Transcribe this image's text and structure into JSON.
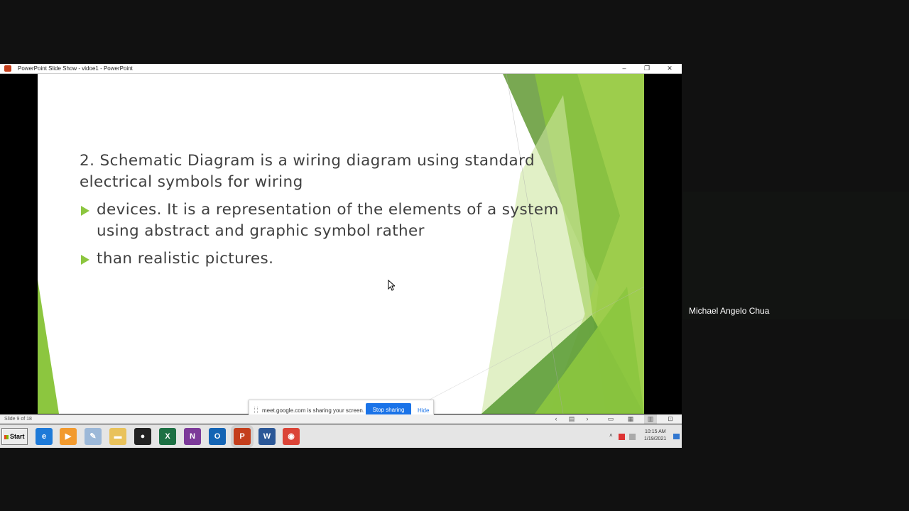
{
  "window": {
    "title": "PowerPoint Slide Show  -  vidoe1 - PowerPoint",
    "minimize_glyph": "–",
    "restore_glyph": "❐",
    "close_glyph": "✕"
  },
  "slide": {
    "heading_line1": "2. Schematic Diagram is a wiring diagram using standard",
    "heading_line2": "electrical symbols for wiring",
    "bullets": [
      {
        "line1": "devices. It is a representation of the elements of a system",
        "line2": "using abstract and graphic symbol rather"
      },
      {
        "line1": "than realistic pictures.",
        "line2": ""
      }
    ],
    "accent_colors": [
      "#8cc63f",
      "#5f9e3a",
      "#b5d96a"
    ]
  },
  "share_bar": {
    "message": "meet.google.com is sharing your screen.",
    "stop_label": "Stop sharing",
    "hide_label": "Hide"
  },
  "status_bar": {
    "slide_counter": "Slide 9 of 18",
    "prev_glyph": "‹",
    "menu_glyph": "▤",
    "next_glyph": "›",
    "normal_glyph": "▭",
    "sorter_glyph": "▦",
    "reading_glyph": "▥",
    "slideshow_glyph": "⊡"
  },
  "taskbar": {
    "start_label": "Start",
    "apps": [
      {
        "name": "Internet Explorer",
        "icon": "ie-icon",
        "glyph": "e",
        "color": "#1e7ad8"
      },
      {
        "name": "Media Player",
        "icon": "media-player-icon",
        "glyph": "▶",
        "color": "#f29a2e"
      },
      {
        "name": "Paint",
        "icon": "paint-icon",
        "glyph": "✎",
        "color": "#9cb8d8"
      },
      {
        "name": "File Explorer",
        "icon": "folder-icon",
        "glyph": "▬",
        "color": "#e9c25b"
      },
      {
        "name": "Recorder",
        "icon": "record-icon",
        "glyph": "●",
        "color": "#222222"
      },
      {
        "name": "Excel",
        "icon": "excel-icon",
        "glyph": "X",
        "color": "#1d7044"
      },
      {
        "name": "OneNote",
        "icon": "onenote-icon",
        "glyph": "N",
        "color": "#7c3a99"
      },
      {
        "name": "Outlook",
        "icon": "outlook-icon",
        "glyph": "O",
        "color": "#1464b4"
      },
      {
        "name": "PowerPoint",
        "icon": "powerpoint-icon",
        "glyph": "P",
        "color": "#c43e1c"
      },
      {
        "name": "Word",
        "icon": "word-icon",
        "glyph": "W",
        "color": "#2b5797"
      },
      {
        "name": "Chrome",
        "icon": "chrome-icon",
        "glyph": "◉",
        "color": "#db4437"
      }
    ],
    "active_app": "PowerPoint",
    "tray_chevron": "˄",
    "time": "10:15 AM",
    "date": "1/19/2021"
  },
  "participant": {
    "name": "Michael Angelo Chua"
  }
}
